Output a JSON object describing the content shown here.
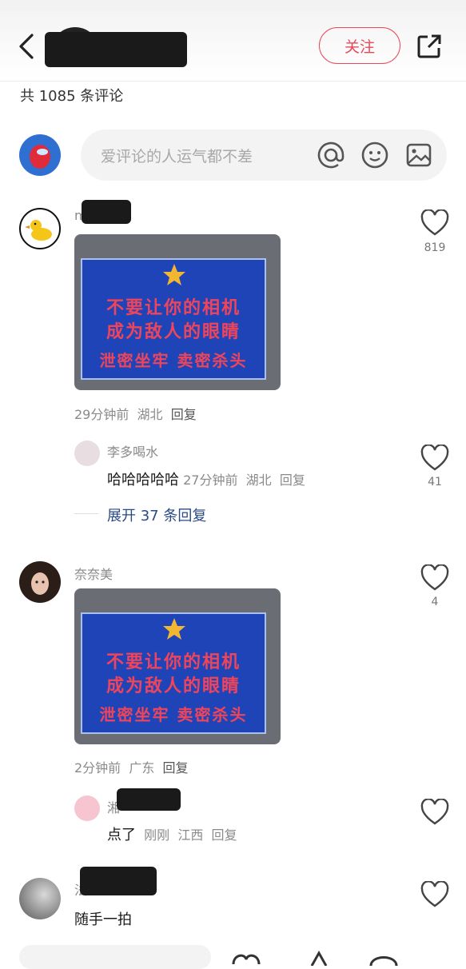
{
  "header": {
    "follow_label": "关注"
  },
  "comment_count_text": "共 1085 条评论",
  "input": {
    "placeholder": "爱评论的人运气都不差"
  },
  "sign": {
    "line1": "不要让你的相机",
    "line2": "成为敌人的眼睛",
    "line3": "泄密坐牢  卖密杀头"
  },
  "comments": [
    {
      "username": "m",
      "time": "29分钟前",
      "location": "湖北",
      "reply_label": "回复",
      "likes": "819",
      "reply": {
        "username": "李多喝水",
        "text": "哈哈哈哈哈",
        "time": "27分钟前",
        "location": "湖北",
        "reply_label": "回复",
        "likes": "41"
      },
      "expand_text": "展开 37 条回复"
    },
    {
      "username": "奈奈美",
      "time": "2分钟前",
      "location": "广东",
      "reply_label": "回复",
      "likes": "4",
      "reply": {
        "username": "湘",
        "text": "点了",
        "time": "刚刚",
        "location": "江西",
        "reply_label": "回复"
      }
    },
    {
      "username": "法",
      "text": "随手一拍"
    }
  ],
  "colors": {
    "accent": "#e8495a",
    "link": "#2a4a86",
    "sign_blue": "#1f44b8",
    "sign_text": "#f0445a"
  }
}
